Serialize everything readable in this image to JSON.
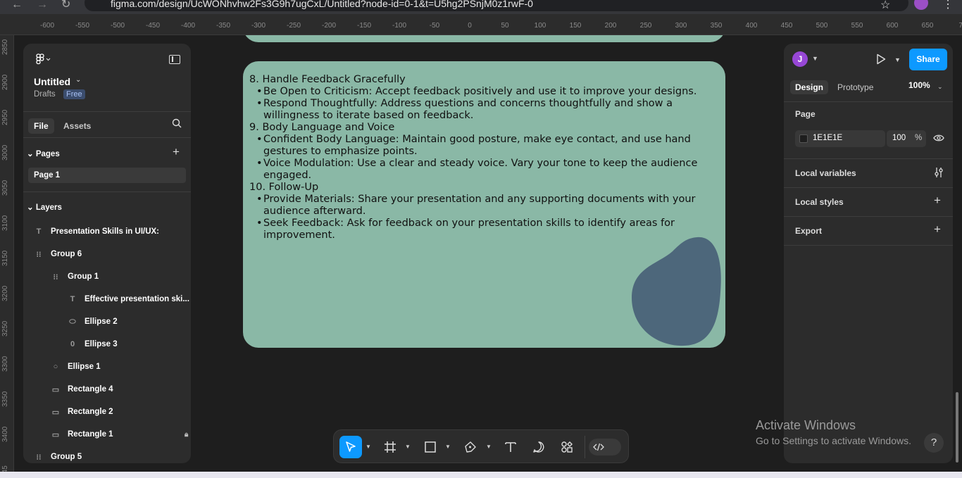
{
  "browser": {
    "url": "figma.com/design/UcWONhvhw2Fs3G9h7ugCxL/Untitled?node-id=0-1&t=U5hg2PSnjM0z1rwF-0"
  },
  "ruler": {
    "top": [
      "-600",
      "-550",
      "-500",
      "-450",
      "-400",
      "-350",
      "-300",
      "-250",
      "-200",
      "-150",
      "-100",
      "-50",
      "0",
      "50",
      "100",
      "150",
      "200",
      "250",
      "300",
      "350",
      "400",
      "450",
      "500",
      "550",
      "600",
      "650",
      "70"
    ],
    "left": [
      "2850",
      "2900",
      "2950",
      "3000",
      "3050",
      "3100",
      "3150",
      "3200",
      "3250",
      "3300",
      "3350",
      "3400",
      "345"
    ]
  },
  "file": {
    "title": "Untitled",
    "location": "Drafts",
    "plan_badge": "Free"
  },
  "left_tabs": {
    "file": "File",
    "assets": "Assets"
  },
  "pages": {
    "header": "Pages",
    "items": [
      "Page 1"
    ]
  },
  "layers": {
    "header": "Layers",
    "items": [
      {
        "label": "Presentation Skills in UI/UX:",
        "icon": "text-icon"
      },
      {
        "label": "Group 6",
        "icon": "group-icon"
      },
      {
        "label": "Group 1",
        "icon": "group-icon"
      },
      {
        "label": "Effective presentation ski...",
        "icon": "text-icon"
      },
      {
        "label": "Ellipse 2",
        "icon": "ellipse-icon"
      },
      {
        "label": "Ellipse 3",
        "icon": "ellipse-icon"
      },
      {
        "label": "Ellipse 1",
        "icon": "ellipse-icon"
      },
      {
        "label": "Rectangle 4",
        "icon": "rectangle-icon"
      },
      {
        "label": "Rectangle 2",
        "icon": "rectangle-icon"
      },
      {
        "label": "Rectangle 1",
        "icon": "rectangle-icon",
        "locked": true
      },
      {
        "label": "Group 5",
        "icon": "group-icon"
      }
    ]
  },
  "canvas_text": {
    "h8": "8. Handle Feedback Gracefully",
    "b8a": "Be Open to Criticism: Accept feedback positively and use it to improve your designs.",
    "b8b": "Respond Thoughtfully: Address questions and concerns thoughtfully and show a willingness to iterate based on feedback.",
    "h9": "9. Body Language and Voice",
    "b9a": "Confident Body Language: Maintain good posture, make eye contact, and use hand gestures to emphasize points.",
    "b9b": "Voice Modulation: Use a clear and steady voice. Vary your tone to keep the audience engaged.",
    "h10": "10. Follow-Up",
    "b10a": "Provide Materials: Share your presentation and any supporting documents with your audience afterward.",
    "b10b": "Seek Feedback: Ask for feedback on your presentation skills to identify areas for improvement."
  },
  "right_panel": {
    "avatar_initial": "J",
    "share_label": "Share",
    "tabs": {
      "design": "Design",
      "prototype": "Prototype"
    },
    "zoom": "100%",
    "page_label": "Page",
    "page_color": "1E1E1E",
    "page_opacity": "100",
    "percent": "%",
    "local_variables": "Local variables",
    "local_styles": "Local styles",
    "export": "Export"
  },
  "windows": {
    "activate_title": "Activate Windows",
    "activate_sub": "Go to Settings to activate Windows."
  },
  "help_label": "?",
  "colors": {
    "frame": "#8ab8a6",
    "blob": "#4d677b",
    "accent": "#0d99ff"
  }
}
